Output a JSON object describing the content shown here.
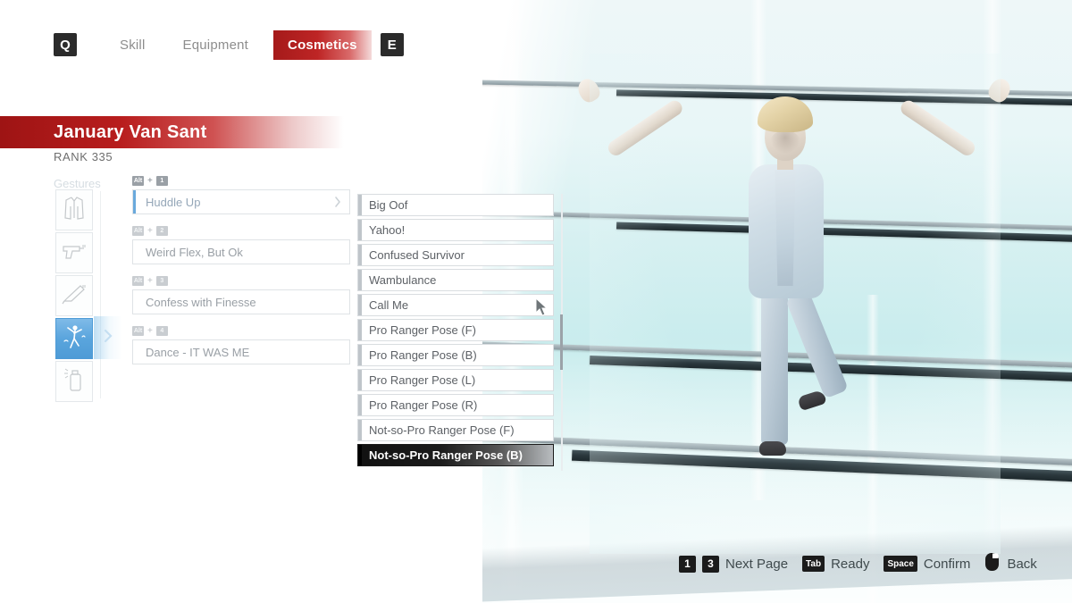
{
  "topnav": {
    "left_key": "Q",
    "right_key": "E",
    "tabs": [
      {
        "label": "Skill",
        "selected": false
      },
      {
        "label": "Equipment",
        "selected": false
      },
      {
        "label": "Cosmetics",
        "selected": true
      }
    ],
    "accent_color": "#be2525"
  },
  "character": {
    "name": "January Van Sant",
    "rank": "RANK 335",
    "banner_color": "#b81d1d"
  },
  "categories": {
    "label": "Gestures",
    "selected_index": 3,
    "selected_color": "#5aa5dd",
    "items": [
      {
        "icon": "jacket-icon",
        "label": "Outfit"
      },
      {
        "icon": "pistol-icon",
        "label": "Sidearm"
      },
      {
        "icon": "melee-weapon-icon",
        "label": "Melee"
      },
      {
        "icon": "dancing-figure-icon",
        "label": "Gestures"
      },
      {
        "icon": "spray-can-icon",
        "label": "Spray"
      }
    ],
    "chevron": "chevron-right-icon"
  },
  "slots": {
    "chevron": "chevron-right-icon",
    "items": [
      {
        "keys": [
          "Alt",
          "1"
        ],
        "separator": "+",
        "value": "Huddle Up",
        "active": true
      },
      {
        "keys": [
          "Alt",
          "2"
        ],
        "separator": "+",
        "value": "Weird Flex, But Ok",
        "active": false
      },
      {
        "keys": [
          "Alt",
          "3"
        ],
        "separator": "+",
        "value": "Confess with Finesse",
        "active": false
      },
      {
        "keys": [
          "Alt",
          "4"
        ],
        "separator": "+",
        "value": "Dance - IT WAS ME",
        "active": false
      }
    ]
  },
  "item_list": {
    "selected_index": 10,
    "scrollbar": {
      "visible": true,
      "thumb_position_pct": 44
    },
    "items": [
      {
        "label": "Big Oof"
      },
      {
        "label": "Yahoo!"
      },
      {
        "label": "Confused Survivor"
      },
      {
        "label": "Wambulance"
      },
      {
        "label": "Call Me"
      },
      {
        "label": "Pro Ranger Pose (F)"
      },
      {
        "label": "Pro Ranger Pose (B)"
      },
      {
        "label": "Pro Ranger Pose (L)"
      },
      {
        "label": "Pro Ranger Pose (R)"
      },
      {
        "label": "Not-so-Pro Ranger Pose (F)"
      },
      {
        "label": "Not-so-Pro Ranger Pose (B)"
      }
    ]
  },
  "cursor": {
    "icon": "mouse-pointer-icon",
    "on_item": "Call Me"
  },
  "hints": [
    {
      "keys": [
        "1",
        "3"
      ],
      "key_style": "sq",
      "label": "Next Page"
    },
    {
      "keys": [
        "Tab"
      ],
      "key_style": "wd",
      "label": "Ready"
    },
    {
      "keys": [
        "Space"
      ],
      "key_style": "wd",
      "label": "Confirm"
    },
    {
      "icon": "mouse-right-click-icon",
      "label": "Back"
    }
  ],
  "viewport": {
    "scene": "character-preview",
    "background_color": "#cfeff0",
    "character_pose": "arms-spread-t-pose"
  }
}
